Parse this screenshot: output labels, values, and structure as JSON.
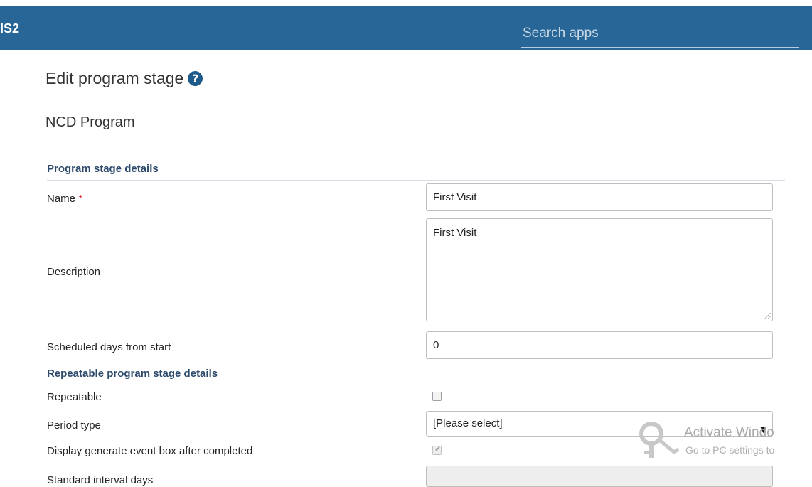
{
  "header": {
    "brand": "IS2",
    "search_placeholder": "Search apps"
  },
  "page": {
    "title": "Edit program stage",
    "help_icon": "question-circle-icon",
    "program_name": "NCD Program"
  },
  "sections": {
    "details_title": "Program stage details",
    "repeatable_title": "Repeatable program stage details"
  },
  "fields": {
    "name": {
      "label": "Name",
      "required_mark": "*",
      "value": "First Visit"
    },
    "description": {
      "label": "Description",
      "value": "First Visit"
    },
    "scheduled_days": {
      "label": "Scheduled days from start",
      "value": "0"
    },
    "repeatable": {
      "label": "Repeatable",
      "checked": false
    },
    "period_type": {
      "label": "Period type",
      "value": "[Please select]"
    },
    "display_generate_event": {
      "label": "Display generate event box after completed",
      "checked": true,
      "disabled": true
    },
    "standard_interval_days": {
      "label": "Standard interval days",
      "value": ""
    }
  },
  "watermark": {
    "title": "Activate Windo",
    "subtitle": "Go to PC settings to",
    "icon": "key-icon"
  },
  "colors": {
    "topbar": "#276696",
    "section_header": "#2d4a6c",
    "required": "#e02020"
  }
}
